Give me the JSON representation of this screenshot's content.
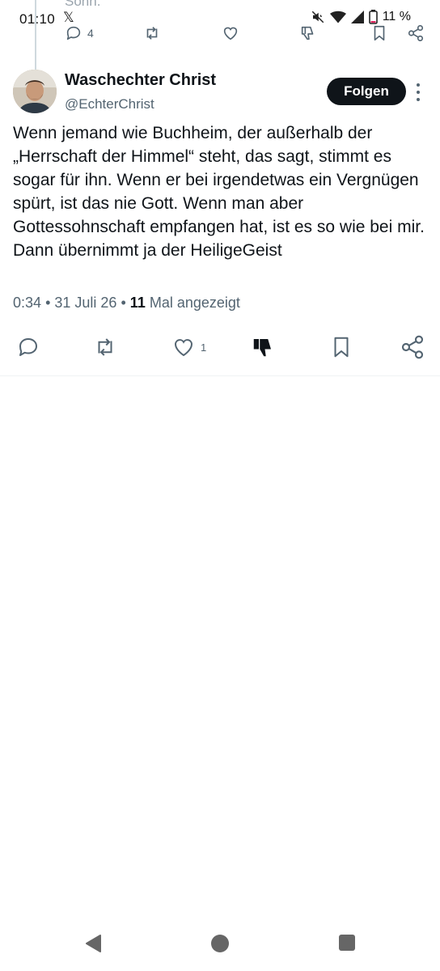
{
  "status_bar": {
    "time": "01:10",
    "app_glyph": "𝕏",
    "battery": "11 %",
    "icons": [
      "mute-icon",
      "wifi-icon",
      "signal-icon",
      "battery-icon"
    ]
  },
  "previous_tweet": {
    "text_fragment": "Sohn.",
    "reply_count": "4"
  },
  "tweet": {
    "author_name": "Waschechter Christ",
    "author_handle": "@EchterChrist",
    "follow_label": "Folgen",
    "text": "Wenn jemand wie Buchheim, der außerhalb der „Herrschaft der Himmel“ steht, das sagt, stimmt es sogar für ihn. Wenn er bei irgendetwas ein Vergnügen spürt, ist das nie Gott. Wenn man aber Gottessohnschaft empfangen hat, ist es so wie bei mir. Dann übernimmt ja der HeiligeGeist",
    "time": "0:34",
    "date": "31 Juli 26",
    "separator": "•",
    "views": "11",
    "views_label": "Mal angezeigt",
    "like_count": "1"
  },
  "colors": {
    "text": "#0f1419",
    "secondary": "#536471",
    "follow_bg": "#0f1419",
    "divider": "#eff3f4"
  }
}
